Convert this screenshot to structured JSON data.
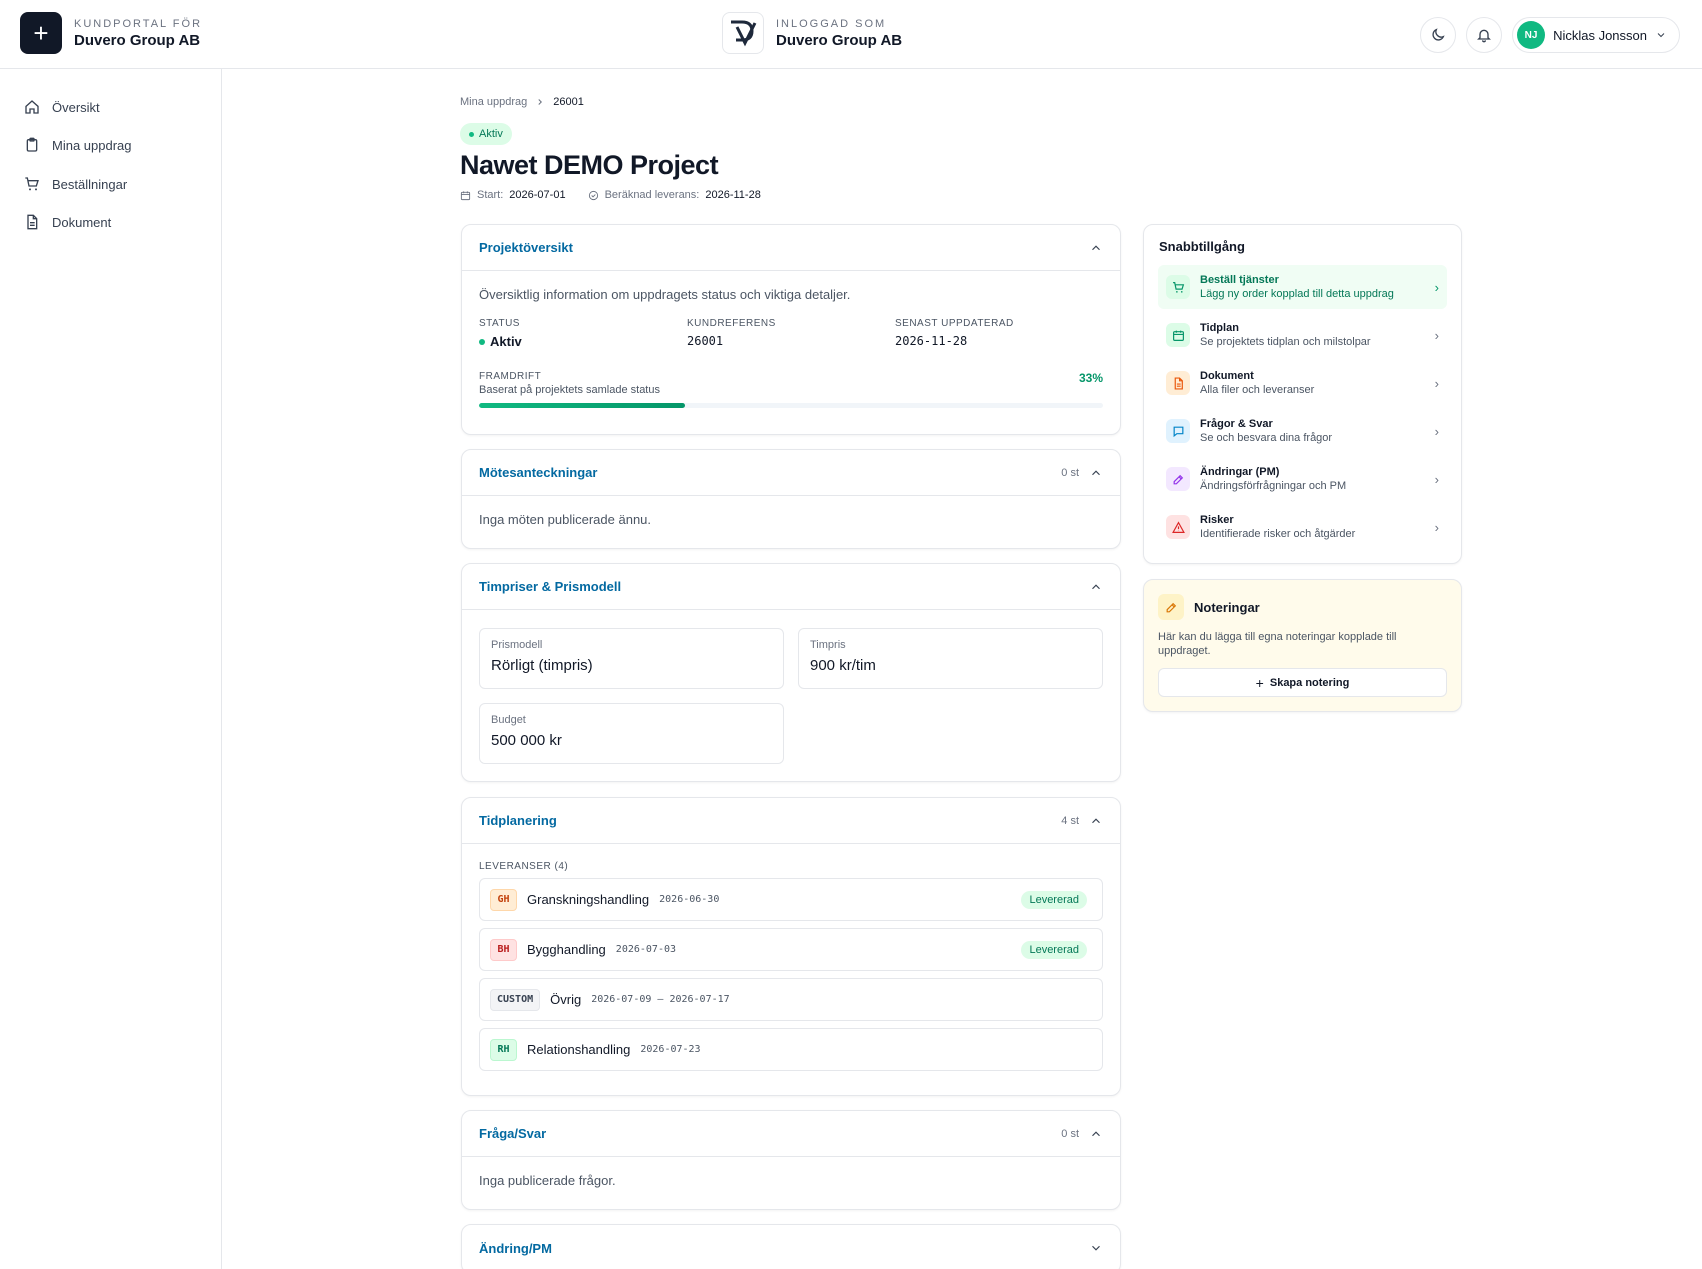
{
  "header": {
    "portal_label": "KUNDPORTAL FÖR",
    "portal_company": "Duvero Group AB",
    "logged_in_label": "INLOGGAD SOM",
    "logged_in_company": "Duvero Group AB",
    "user_initials": "NJ",
    "user_name": "Nicklas Jonsson"
  },
  "sidebar": {
    "items": [
      {
        "label": "Översikt",
        "icon": "home-icon"
      },
      {
        "label": "Mina uppdrag",
        "icon": "clipboard-icon"
      },
      {
        "label": "Beställningar",
        "icon": "cart-icon"
      },
      {
        "label": "Dokument",
        "icon": "document-icon"
      }
    ]
  },
  "breadcrumb": {
    "parent": "Mina uppdrag",
    "current": "26001"
  },
  "project": {
    "status_badge": "Aktiv",
    "title": "Nawet DEMO Project",
    "start_label": "Start:",
    "start_date": "2026-07-01",
    "delivery_label": "Beräknad leverans:",
    "delivery_date": "2026-11-28"
  },
  "overview": {
    "title": "Projektöversikt",
    "description": "Översiktlig information om uppdragets status och viktiga detaljer.",
    "status_label": "STATUS",
    "status_value": "Aktiv",
    "reference_label": "KUNDREFERENS",
    "reference_value": "26001",
    "updated_label": "SENAST UPPDATERAD",
    "updated_value": "2026-11-28",
    "progress_label": "FRAMDRIFT",
    "progress_sub": "Baserat på projektets samlade status",
    "progress_text": "33%",
    "progress_value": 0.33
  },
  "meetings": {
    "title": "Mötesanteckningar",
    "count": "0 st",
    "empty": "Inga möten publicerade ännu."
  },
  "pricing": {
    "title": "Timpriser & Prismodell",
    "model_label": "Prismodell",
    "model_value": "Rörligt (timpris)",
    "rate_label": "Timpris",
    "rate_value": "900 kr/tim",
    "budget_label": "Budget",
    "budget_value": "500 000 kr"
  },
  "schedule": {
    "title": "Tidplanering",
    "count": "4 st",
    "deliverables_label": "LEVERANSER (4)",
    "items": [
      {
        "tag": "GH",
        "name": "Granskningshandling",
        "date": "2026-06-30",
        "status": "Levererad"
      },
      {
        "tag": "BH",
        "name": "Bygghandling",
        "date": "2026-07-03",
        "status": "Levererad"
      },
      {
        "tag": "CUSTOM",
        "name": "Övrig",
        "date": "2026-07-09 – 2026-07-17",
        "status": ""
      },
      {
        "tag": "RH",
        "name": "Relationshandling",
        "date": "2026-07-23",
        "status": ""
      }
    ]
  },
  "qa": {
    "title": "Fråga/Svar",
    "count": "0 st",
    "empty": "Inga publicerade frågor."
  },
  "changes": {
    "title": "Ändring/PM"
  },
  "quick_access": {
    "title": "Snabbtillgång",
    "items": [
      {
        "name": "Beställ tjänster",
        "desc": "Lägg ny order kopplad till detta uppdrag",
        "icon": "cart-icon"
      },
      {
        "name": "Tidplan",
        "desc": "Se projektets tidplan och milstolpar",
        "icon": "calendar-icon"
      },
      {
        "name": "Dokument",
        "desc": "Alla filer och leveranser",
        "icon": "document-icon"
      },
      {
        "name": "Frågor & Svar",
        "desc": "Se och besvara dina frågor",
        "icon": "chat-icon"
      },
      {
        "name": "Ändringar (PM)",
        "desc": "Ändringsförfrågningar och PM",
        "icon": "edit-icon"
      },
      {
        "name": "Risker",
        "desc": "Identifierade risker och åtgärder",
        "icon": "warning-icon"
      }
    ]
  },
  "notes": {
    "title": "Noteringar",
    "description": "Här kan du lägga till egna noteringar kopplade till uppdraget.",
    "button": "Skapa notering"
  }
}
